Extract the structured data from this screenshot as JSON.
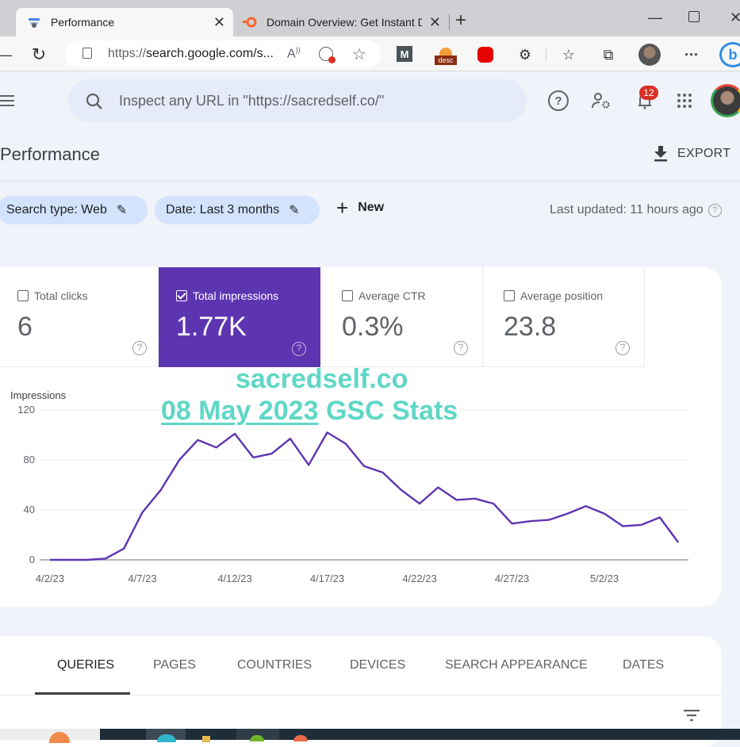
{
  "browser": {
    "tabs": [
      {
        "title": "Performance",
        "icon": "search-console-icon",
        "active": true
      },
      {
        "title": "Domain Overview: Get Instant Do",
        "icon": "semrush-icon",
        "active": false
      }
    ],
    "new_tab": "+",
    "url_prefix": "https://",
    "url_main": "search.google.com/s...",
    "toolbar_icons": [
      "read-aloud-icon",
      "cookie-blocked-icon",
      "add-favorite-icon",
      "extension-m-icon",
      "extension-desc-icon",
      "adblock-icon",
      "extensions-icon",
      "favorites-icon",
      "collections-icon",
      "profile-icon",
      "more-icon",
      "bing-icon"
    ],
    "desc_label": "desc",
    "m_label": "M",
    "more_label": "···"
  },
  "gsc": {
    "search_placeholder": "Inspect any URL in \"https://sacredself.co/\"",
    "notification_count": "12",
    "page_title": "Performance",
    "export_label": "EXPORT",
    "filters": {
      "search_type": "Search type: Web",
      "date": "Date: Last 3 months",
      "new_label": "New"
    },
    "last_updated": "Last updated: 11 hours ago",
    "metrics": [
      {
        "label": "Total clicks",
        "value": "6",
        "checked": false
      },
      {
        "label": "Total impressions",
        "value": "1.77K",
        "checked": true
      },
      {
        "label": "Average CTR",
        "value": "0.3%",
        "checked": false
      },
      {
        "label": "Average position",
        "value": "23.8",
        "checked": false
      }
    ],
    "help_glyph": "?",
    "watermark": {
      "line1": "sacredself.co",
      "line2_underlined": "08 May 2023",
      "line2_rest": " GSC Stats"
    },
    "report_tabs": [
      {
        "label": "QUERIES",
        "active": true
      },
      {
        "label": "PAGES",
        "active": false
      },
      {
        "label": "COUNTRIES",
        "active": false
      },
      {
        "label": "DEVICES",
        "active": false
      },
      {
        "label": "SEARCH APPEARANCE",
        "active": false
      },
      {
        "label": "DATES",
        "active": false
      }
    ],
    "accent_color": "#5e35b1",
    "line_color": "#5e35b1"
  },
  "chart_data": {
    "type": "line",
    "title": "",
    "ylabel": "Impressions",
    "xlabel": "",
    "ylim": [
      0,
      120
    ],
    "yticks": [
      0,
      40,
      80,
      120
    ],
    "xtick_labels": [
      "4/2/23",
      "4/7/23",
      "4/12/23",
      "4/17/23",
      "4/22/23",
      "4/27/23",
      "5/2/23"
    ],
    "xtick_indices": [
      0,
      5,
      10,
      15,
      20,
      25,
      30
    ],
    "grid": true,
    "x": [
      "4/2/23",
      "4/3/23",
      "4/4/23",
      "4/5/23",
      "4/6/23",
      "4/7/23",
      "4/8/23",
      "4/9/23",
      "4/10/23",
      "4/11/23",
      "4/12/23",
      "4/13/23",
      "4/14/23",
      "4/15/23",
      "4/16/23",
      "4/17/23",
      "4/18/23",
      "4/19/23",
      "4/20/23",
      "4/21/23",
      "4/22/23",
      "4/23/23",
      "4/24/23",
      "4/25/23",
      "4/26/23",
      "4/27/23",
      "4/28/23",
      "4/29/23",
      "4/30/23",
      "5/1/23",
      "5/2/23",
      "5/3/23",
      "5/4/23",
      "5/5/23",
      "5/6/23"
    ],
    "series": [
      {
        "name": "Impressions",
        "values": [
          0,
          0,
          0,
          1,
          9,
          38,
          56,
          80,
          96,
          90,
          101,
          82,
          85,
          97,
          76,
          102,
          93,
          75,
          70,
          56,
          45,
          58,
          48,
          49,
          45,
          29,
          31,
          32,
          37,
          43,
          37,
          27,
          28,
          34,
          14
        ]
      }
    ]
  }
}
